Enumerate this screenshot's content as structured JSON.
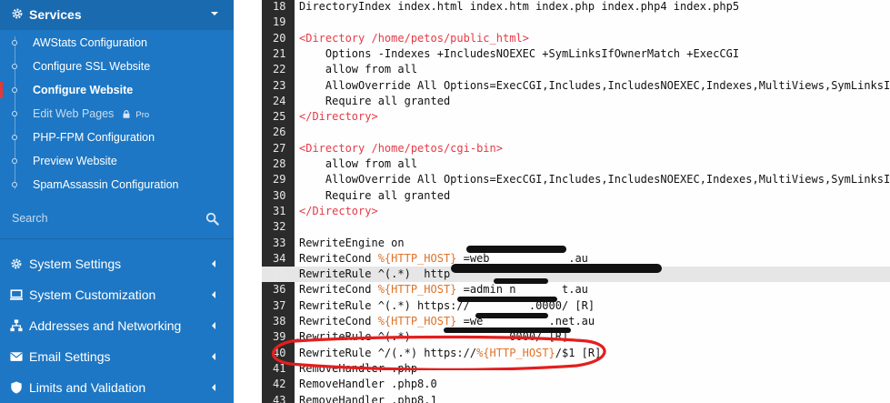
{
  "sidebar": {
    "header": {
      "label": "Services",
      "icon": "gear-icon"
    },
    "sub_items": [
      {
        "label": "AWStats Configuration"
      },
      {
        "label": "Configure SSL Website"
      },
      {
        "label": "Configure Website",
        "active": true
      },
      {
        "label": "Edit Web Pages",
        "badge": "Pro",
        "icon": "lock-icon"
      },
      {
        "label": "PHP-FPM Configuration"
      },
      {
        "label": "Preview Website"
      },
      {
        "label": "SpamAssassin Configuration"
      }
    ],
    "search": {
      "placeholder": "Search",
      "icon": "search-icon"
    },
    "categories": [
      {
        "label": "System Settings",
        "icon": "gear-icon"
      },
      {
        "label": "System Customization",
        "icon": "monitor-icon"
      },
      {
        "label": "Addresses and Networking",
        "icon": "network-icon"
      },
      {
        "label": "Email Settings",
        "icon": "envelope-icon"
      },
      {
        "label": "Limits and Validation",
        "icon": "shield-icon"
      }
    ],
    "colors": {
      "background": "#1d77c4",
      "active_marker": "#e53935"
    }
  },
  "editor": {
    "lines": [
      {
        "n": "18",
        "text": "DirectoryIndex index.html index.htm index.php index.php4 index.php5"
      },
      {
        "n": "19",
        "text": ""
      },
      {
        "n": "20",
        "text": "<Directory /home/petos/public_html>"
      },
      {
        "n": "21",
        "text": "    Options -Indexes +IncludesNOEXEC +SymLinksIfOwnerMatch +ExecCGI"
      },
      {
        "n": "22",
        "text": "    allow from all"
      },
      {
        "n": "23",
        "text": "    AllowOverride All Options=ExecCGI,Includes,IncludesNOEXEC,Indexes,MultiViews,SymLinksIf"
      },
      {
        "n": "24",
        "text": "    Require all granted"
      },
      {
        "n": "25",
        "text": "</Directory>"
      },
      {
        "n": "26",
        "text": ""
      },
      {
        "n": "27",
        "text": "<Directory /home/petos/cgi-bin>"
      },
      {
        "n": "28",
        "text": "    allow from all"
      },
      {
        "n": "29",
        "text": "    AllowOverride All Options=ExecCGI,Includes,IncludesNOEXEC,Indexes,MultiViews,SymLinksIf"
      },
      {
        "n": "30",
        "text": "    Require all granted"
      },
      {
        "n": "31",
        "text": "</Directory>"
      },
      {
        "n": "32",
        "text": ""
      },
      {
        "n": "33",
        "text": "RewriteEngine on"
      },
      {
        "n": "34",
        "text": "RewriteCond %{HTTP_HOST} =web            .au"
      },
      {
        "n": "35",
        "text": "RewriteRule ^(.*)  http"
      },
      {
        "n": "36",
        "text": "RewriteCond %{HTTP_HOST} =admin n       t.au"
      },
      {
        "n": "37",
        "text": "RewriteRule ^(.*) https://         .0000/ [R]"
      },
      {
        "n": "38",
        "text": "RewriteCond %{HTTP_HOST} =we          .net.au"
      },
      {
        "n": "39",
        "text": "RewriteRule ^(.*)               0000/ [R]"
      },
      {
        "n": "40",
        "text": "RewriteRule ^/(.*) https://%{HTTP_HOST}/$1 [R]"
      },
      {
        "n": "41",
        "text": "RemoveHandler .php"
      },
      {
        "n": "42",
        "text": "RemoveHandler .php8.0"
      },
      {
        "n": "43",
        "text": "RemoveHandler .php8.1"
      }
    ],
    "highlighted_line": "35",
    "colors": {
      "directive_tag": "#e63946",
      "variable": "#e0732a",
      "gutter": "#2b2b2b",
      "annotation": "#e41e1e"
    }
  }
}
